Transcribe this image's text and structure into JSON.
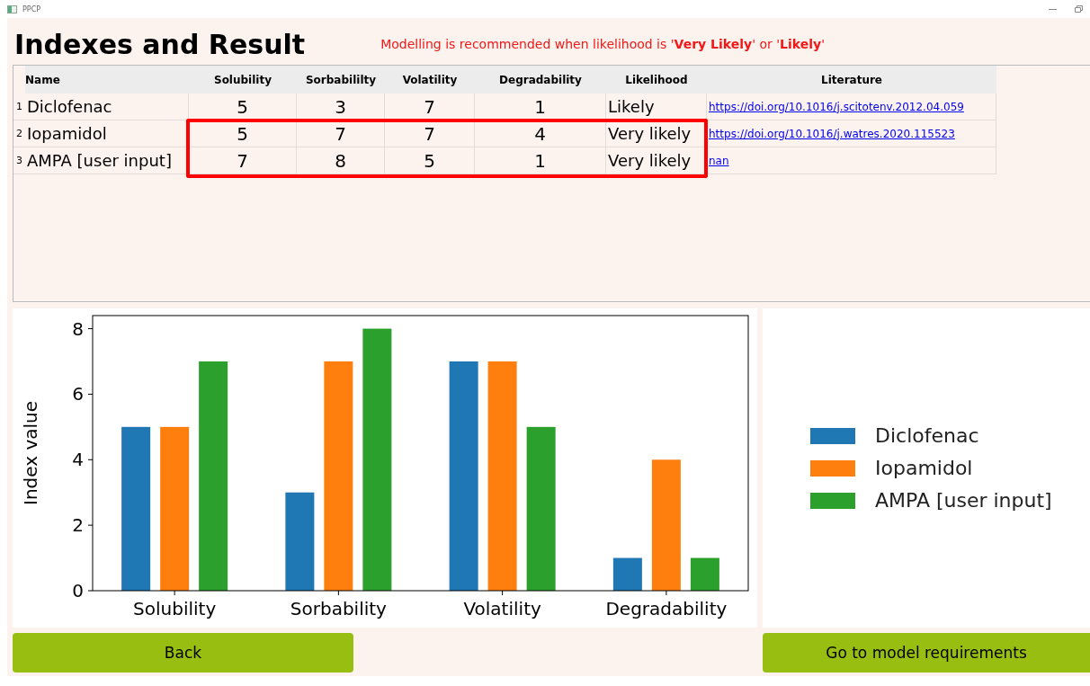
{
  "window": {
    "title": "PPCP"
  },
  "heading": "Indexes and Result",
  "notice": "Modelling is recommended when likelihood is '**Very Likely**' or '**Likely**'",
  "table": {
    "columns": [
      "Name",
      "Solubility",
      "Sorbabililty",
      "Volatility",
      "Degradability",
      "Likelihood",
      "Literature"
    ],
    "rows": [
      {
        "number": "1",
        "name": "Diclofenac",
        "values": [
          "5",
          "3",
          "7",
          "1"
        ],
        "likelihood": "Likely",
        "literature": "https://doi.org/10.1016/j.scitotenv.2012.04.059",
        "highlighted": false
      },
      {
        "number": "2",
        "name": "Iopamidol",
        "values": [
          "5",
          "7",
          "7",
          "4"
        ],
        "likelihood": "Very likely",
        "literature": "https://doi.org/10.1016/j.watres.2020.115523",
        "highlighted": true
      },
      {
        "number": "3",
        "name": "AMPA [user input]",
        "values": [
          "7",
          "8",
          "5",
          "1"
        ],
        "likelihood": "Very likely",
        "literature": "nan",
        "highlighted": true
      }
    ]
  },
  "chart": {
    "chart_data": {
      "type": "bar",
      "ylabel": "Index value",
      "categories": [
        "Solubility",
        "Sorbability",
        "Volatility",
        "Degradability"
      ],
      "ylim": [
        0,
        8.4
      ],
      "yticks": [
        0,
        2,
        4,
        6,
        8
      ],
      "series": [
        {
          "name": "Diclofenac",
          "color": "#1f77b4",
          "values": [
            5,
            3,
            7,
            1
          ]
        },
        {
          "name": "Iopamidol",
          "color": "#ff7f0e",
          "values": [
            5,
            7,
            7,
            4
          ]
        },
        {
          "name": "AMPA [user input]",
          "color": "#2ca02c",
          "values": [
            7,
            8,
            5,
            1
          ]
        }
      ]
    }
  },
  "buttons": [
    "Back",
    "Go to model requirements"
  ]
}
